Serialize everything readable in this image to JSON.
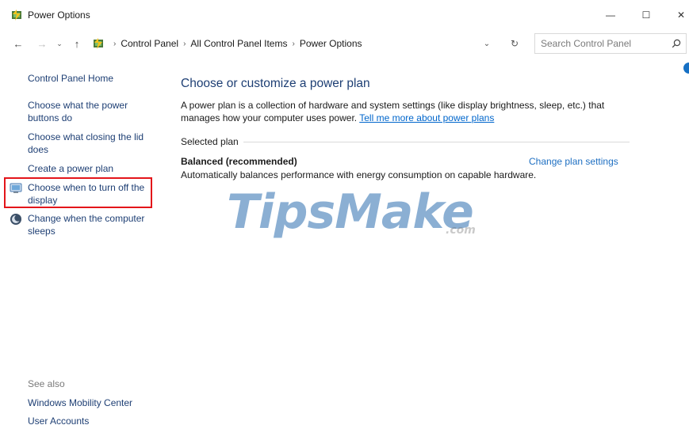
{
  "window": {
    "title": "Power Options",
    "minimize_glyph": "—",
    "maximize_glyph": "☐",
    "close_glyph": "✕"
  },
  "nav": {
    "back_glyph": "←",
    "forward_glyph": "→",
    "recent_glyph": "⌄",
    "up_glyph": "↑",
    "icons": [
      "back-arrow-icon",
      "forward-arrow-icon",
      "recent-locations-icon",
      "up-arrow-icon"
    ]
  },
  "address": {
    "separator": "›",
    "crumbs": [
      "Control Panel",
      "All Control Panel Items",
      "Power Options"
    ],
    "dropdown_glyph": "⌄",
    "refresh_glyph": "↻"
  },
  "search": {
    "placeholder": "Search Control Panel",
    "icon": "search-icon"
  },
  "sidebar": {
    "home": "Control Panel Home",
    "links": [
      "Choose what the power buttons do",
      "Choose what closing the lid does",
      "Create a power plan"
    ],
    "icon_links": [
      {
        "label": "Choose when to turn off the display",
        "icon": "display-icon",
        "highlighted": true
      },
      {
        "label": "Change when the computer sleeps",
        "icon": "moon-sleep-icon",
        "highlighted": false
      }
    ],
    "highlight_color": "#e3151a",
    "see_also": {
      "label": "See also",
      "links": [
        "Windows Mobility Center",
        "User Accounts"
      ]
    }
  },
  "main": {
    "title": "Choose or customize a power plan",
    "description": "A power plan is a collection of hardware and system settings (like display brightness, sleep, etc.) that manages how your computer uses power.",
    "learn_more": "Tell me more about power plans",
    "group_label": "Selected plan",
    "plan_name": "Balanced (recommended)",
    "plan_desc": "Automatically balances performance with energy consumption on capable hardware.",
    "change_plan": "Change plan settings"
  },
  "watermark": {
    "text": "TipsMake",
    "suffix": ".com"
  },
  "colors": {
    "link": "#1e3f74",
    "accent": "#0066cc",
    "help_dot": "#1670c4"
  }
}
